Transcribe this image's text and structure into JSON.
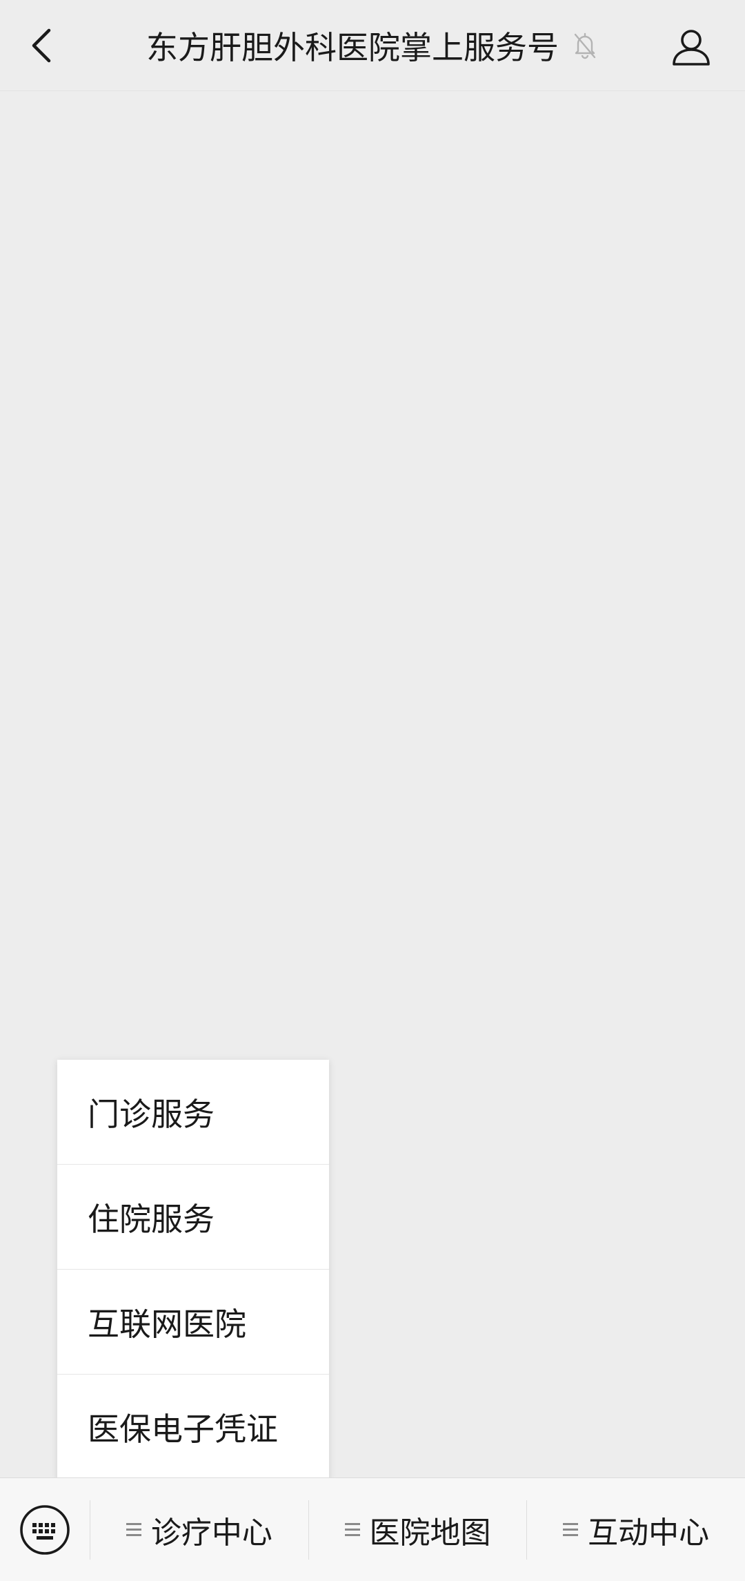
{
  "header": {
    "title": "东方肝胆外科医院掌上服务号",
    "back_icon": "chevron-left-icon",
    "mute_icon": "bell-slash-icon",
    "profile_icon": "user-icon"
  },
  "popup_menu": {
    "items": [
      {
        "label": "门诊服务"
      },
      {
        "label": "住院服务"
      },
      {
        "label": "互联网医院"
      },
      {
        "label": "医保电子凭证"
      }
    ]
  },
  "bottom_bar": {
    "keyboard_icon": "keyboard-icon",
    "tabs": [
      {
        "label": "诊疗中心",
        "icon": "menu-lines-icon"
      },
      {
        "label": "医院地图",
        "icon": "menu-lines-icon"
      },
      {
        "label": "互动中心",
        "icon": "menu-lines-icon"
      }
    ]
  },
  "colors": {
    "background": "#ededed",
    "text": "#1a1a1a",
    "popup_bg": "#ffffff",
    "bar_bg": "#f7f7f7"
  }
}
